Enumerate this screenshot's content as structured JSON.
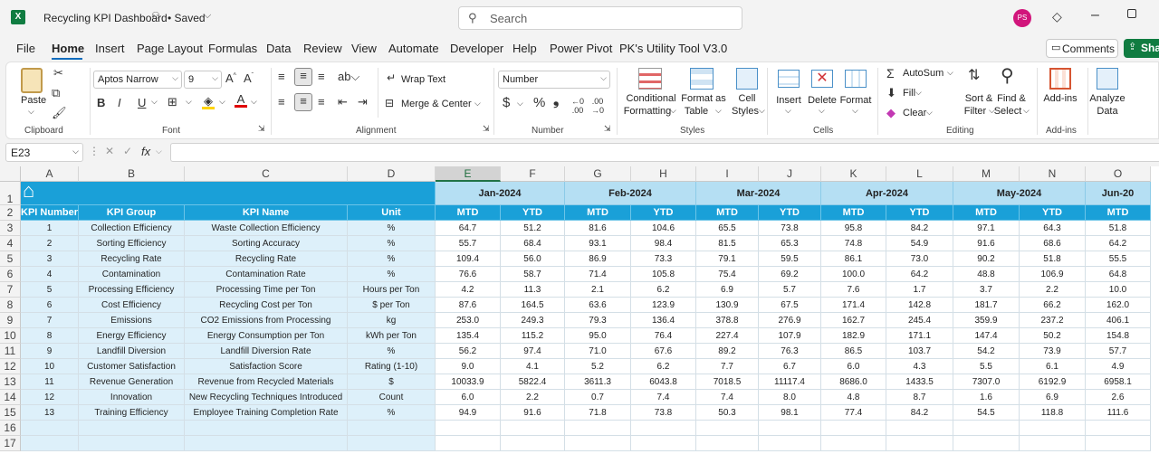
{
  "window": {
    "file_name": "Recycling KPI Dashboard",
    "status": "• Saved",
    "search_placeholder": "Search",
    "user_initials": "PS"
  },
  "menu": {
    "tabs": [
      "File",
      "Home",
      "Insert",
      "Page Layout",
      "Formulas",
      "Data",
      "Review",
      "View",
      "Automate",
      "Developer",
      "Help",
      "Power Pivot",
      "PK's Utility Tool V3.0"
    ],
    "active": "Home",
    "comments_label": "Comments",
    "share_label": "Sha"
  },
  "ribbon": {
    "clipboard": {
      "paste": "Paste",
      "label": "Clipboard"
    },
    "font": {
      "name": "Aptos Narrow",
      "size": "9",
      "bold": "B",
      "italic": "I",
      "underline": "U",
      "label": "Font"
    },
    "alignment": {
      "wrap": "Wrap Text",
      "merge": "Merge & Center",
      "label": "Alignment"
    },
    "number": {
      "format": "Number",
      "currency": "$",
      "percent": "%",
      "comma": "❟",
      "label": "Number"
    },
    "styles": {
      "conditional_1": "Conditional",
      "conditional_2": "Formatting",
      "format_table_1": "Format as",
      "format_table_2": "Table",
      "cell_styles_1": "Cell",
      "cell_styles_2": "Styles",
      "label": "Styles"
    },
    "cells": {
      "insert": "Insert",
      "delete": "Delete",
      "format": "Format",
      "label": "Cells"
    },
    "editing": {
      "autosum": "AutoSum",
      "fill": "Fill",
      "clear": "Clear",
      "sort_1": "Sort &",
      "sort_2": "Filter",
      "find_1": "Find &",
      "find_2": "Select",
      "label": "Editing"
    },
    "addins": {
      "addins": "Add-ins",
      "label": "Add-ins"
    },
    "analyze": {
      "line1": "Analyze",
      "line2": "Data"
    }
  },
  "formula_bar": {
    "name_box": "E23",
    "fx": "fx",
    "content": ""
  },
  "sheet": {
    "columns": [
      "A",
      "B",
      "C",
      "D",
      "E",
      "F",
      "G",
      "H",
      "I",
      "J",
      "K",
      "L",
      "M",
      "N",
      "O"
    ],
    "selected_column": "E",
    "rows": [
      "1",
      "2",
      "3",
      "4",
      "5",
      "6",
      "7",
      "8",
      "9",
      "10",
      "11",
      "12",
      "13",
      "14",
      "15",
      "16",
      "17"
    ],
    "months": [
      "Jan-2024",
      "Feb-2024",
      "Mar-2024",
      "Apr-2024",
      "May-2024",
      "Jun-20"
    ],
    "headers": {
      "kpi_number": "KPI Number",
      "kpi_group": "KPI Group",
      "kpi_name": "KPI Name",
      "unit": "Unit",
      "mtd": "MTD",
      "ytd": "YTD"
    },
    "records": [
      {
        "num": "1",
        "group": "Collection Efficiency",
        "name": "Waste Collection Efficiency",
        "unit": "%",
        "values": [
          "64.7",
          "51.2",
          "81.6",
          "104.6",
          "65.5",
          "73.8",
          "95.8",
          "84.2",
          "97.1",
          "64.3",
          "51.8"
        ]
      },
      {
        "num": "2",
        "group": "Sorting Efficiency",
        "name": "Sorting Accuracy",
        "unit": "%",
        "values": [
          "55.7",
          "68.4",
          "93.1",
          "98.4",
          "81.5",
          "65.3",
          "74.8",
          "54.9",
          "91.6",
          "68.6",
          "64.2"
        ]
      },
      {
        "num": "3",
        "group": "Recycling Rate",
        "name": "Recycling Rate",
        "unit": "%",
        "values": [
          "109.4",
          "56.0",
          "86.9",
          "73.3",
          "79.1",
          "59.5",
          "86.1",
          "73.0",
          "90.2",
          "51.8",
          "55.5"
        ]
      },
      {
        "num": "4",
        "group": "Contamination",
        "name": "Contamination Rate",
        "unit": "%",
        "values": [
          "76.6",
          "58.7",
          "71.4",
          "105.8",
          "75.4",
          "69.2",
          "100.0",
          "64.2",
          "48.8",
          "106.9",
          "64.8"
        ]
      },
      {
        "num": "5",
        "group": "Processing Efficiency",
        "name": "Processing Time per Ton",
        "unit": "Hours per Ton",
        "values": [
          "4.2",
          "11.3",
          "2.1",
          "6.2",
          "6.9",
          "5.7",
          "7.6",
          "1.7",
          "3.7",
          "2.2",
          "10.0"
        ]
      },
      {
        "num": "6",
        "group": "Cost Efficiency",
        "name": "Recycling Cost per Ton",
        "unit": "$ per Ton",
        "values": [
          "87.6",
          "164.5",
          "63.6",
          "123.9",
          "130.9",
          "67.5",
          "171.4",
          "142.8",
          "181.7",
          "66.2",
          "162.0"
        ]
      },
      {
        "num": "7",
        "group": "Emissions",
        "name": "CO2 Emissions from Processing",
        "unit": "kg",
        "values": [
          "253.0",
          "249.3",
          "79.3",
          "136.4",
          "378.8",
          "276.9",
          "162.7",
          "245.4",
          "359.9",
          "237.2",
          "406.1"
        ]
      },
      {
        "num": "8",
        "group": "Energy Efficiency",
        "name": "Energy Consumption per Ton",
        "unit": "kWh per Ton",
        "values": [
          "135.4",
          "115.2",
          "95.0",
          "76.4",
          "227.4",
          "107.9",
          "182.9",
          "171.1",
          "147.4",
          "50.2",
          "154.8"
        ]
      },
      {
        "num": "9",
        "group": "Landfill Diversion",
        "name": "Landfill Diversion Rate",
        "unit": "%",
        "values": [
          "56.2",
          "97.4",
          "71.0",
          "67.6",
          "89.2",
          "76.3",
          "86.5",
          "103.7",
          "54.2",
          "73.9",
          "57.7"
        ]
      },
      {
        "num": "10",
        "group": "Customer Satisfaction",
        "name": "Satisfaction Score",
        "unit": "Rating (1-10)",
        "values": [
          "9.0",
          "4.1",
          "5.2",
          "6.2",
          "7.7",
          "6.7",
          "6.0",
          "4.3",
          "5.5",
          "6.1",
          "4.9"
        ]
      },
      {
        "num": "11",
        "group": "Revenue Generation",
        "name": "Revenue from Recycled Materials",
        "unit": "$",
        "values": [
          "10033.9",
          "5822.4",
          "3611.3",
          "6043.8",
          "7018.5",
          "11117.4",
          "8686.0",
          "1433.5",
          "7307.0",
          "6192.9",
          "6958.1"
        ]
      },
      {
        "num": "12",
        "group": "Innovation",
        "name": "New Recycling Techniques Introduced",
        "unit": "Count",
        "values": [
          "6.0",
          "2.2",
          "0.7",
          "7.4",
          "7.4",
          "8.0",
          "4.8",
          "8.7",
          "1.6",
          "6.9",
          "2.6"
        ]
      },
      {
        "num": "13",
        "group": "Training Efficiency",
        "name": "Employee Training Completion Rate",
        "unit": "%",
        "values": [
          "94.9",
          "91.6",
          "71.8",
          "73.8",
          "50.3",
          "98.1",
          "77.4",
          "84.2",
          "54.5",
          "118.8",
          "111.6"
        ]
      }
    ]
  }
}
